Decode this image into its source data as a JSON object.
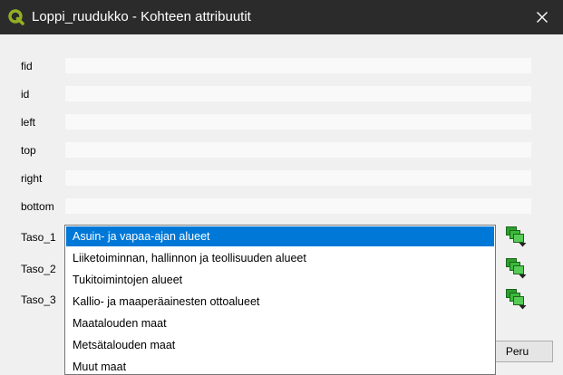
{
  "window": {
    "title": "Loppi_ruudukko - Kohteen attribuutit",
    "app_icon": "qgis-logo-icon",
    "close_icon": "close-icon"
  },
  "colors": {
    "titlebar": "#2b2b2b",
    "background": "#f0f0f0",
    "selection": "#0078d7",
    "qgis_green": "#93b023",
    "layer_icon_green": "#2e9e2e"
  },
  "form": {
    "fields": [
      {
        "label": "fid",
        "value": ""
      },
      {
        "label": "id",
        "value": ""
      },
      {
        "label": "left",
        "value": ""
      },
      {
        "label": "top",
        "value": ""
      },
      {
        "label": "right",
        "value": ""
      },
      {
        "label": "bottom",
        "value": ""
      }
    ],
    "combo_fields": [
      {
        "label": "Taso_1",
        "button_icon": "layer-stack-dropdown-icon"
      },
      {
        "label": "Taso_2",
        "button_icon": "layer-stack-dropdown-icon"
      },
      {
        "label": "Taso_3",
        "button_icon": "layer-stack-dropdown-icon"
      }
    ]
  },
  "dropdown": {
    "options": [
      "Asuin- ja vapaa-ajan alueet",
      "Liiketoiminnan, hallinnon ja teollisuuden alueet",
      "Tukitoimintojen alueet",
      "Kallio- ja maaperäainesten ottoalueet",
      "Maatalouden maat",
      "Metsätalouden maat",
      "Muut maat"
    ],
    "selected_index": 0
  },
  "buttons": {
    "cancel_label": "Peru"
  }
}
